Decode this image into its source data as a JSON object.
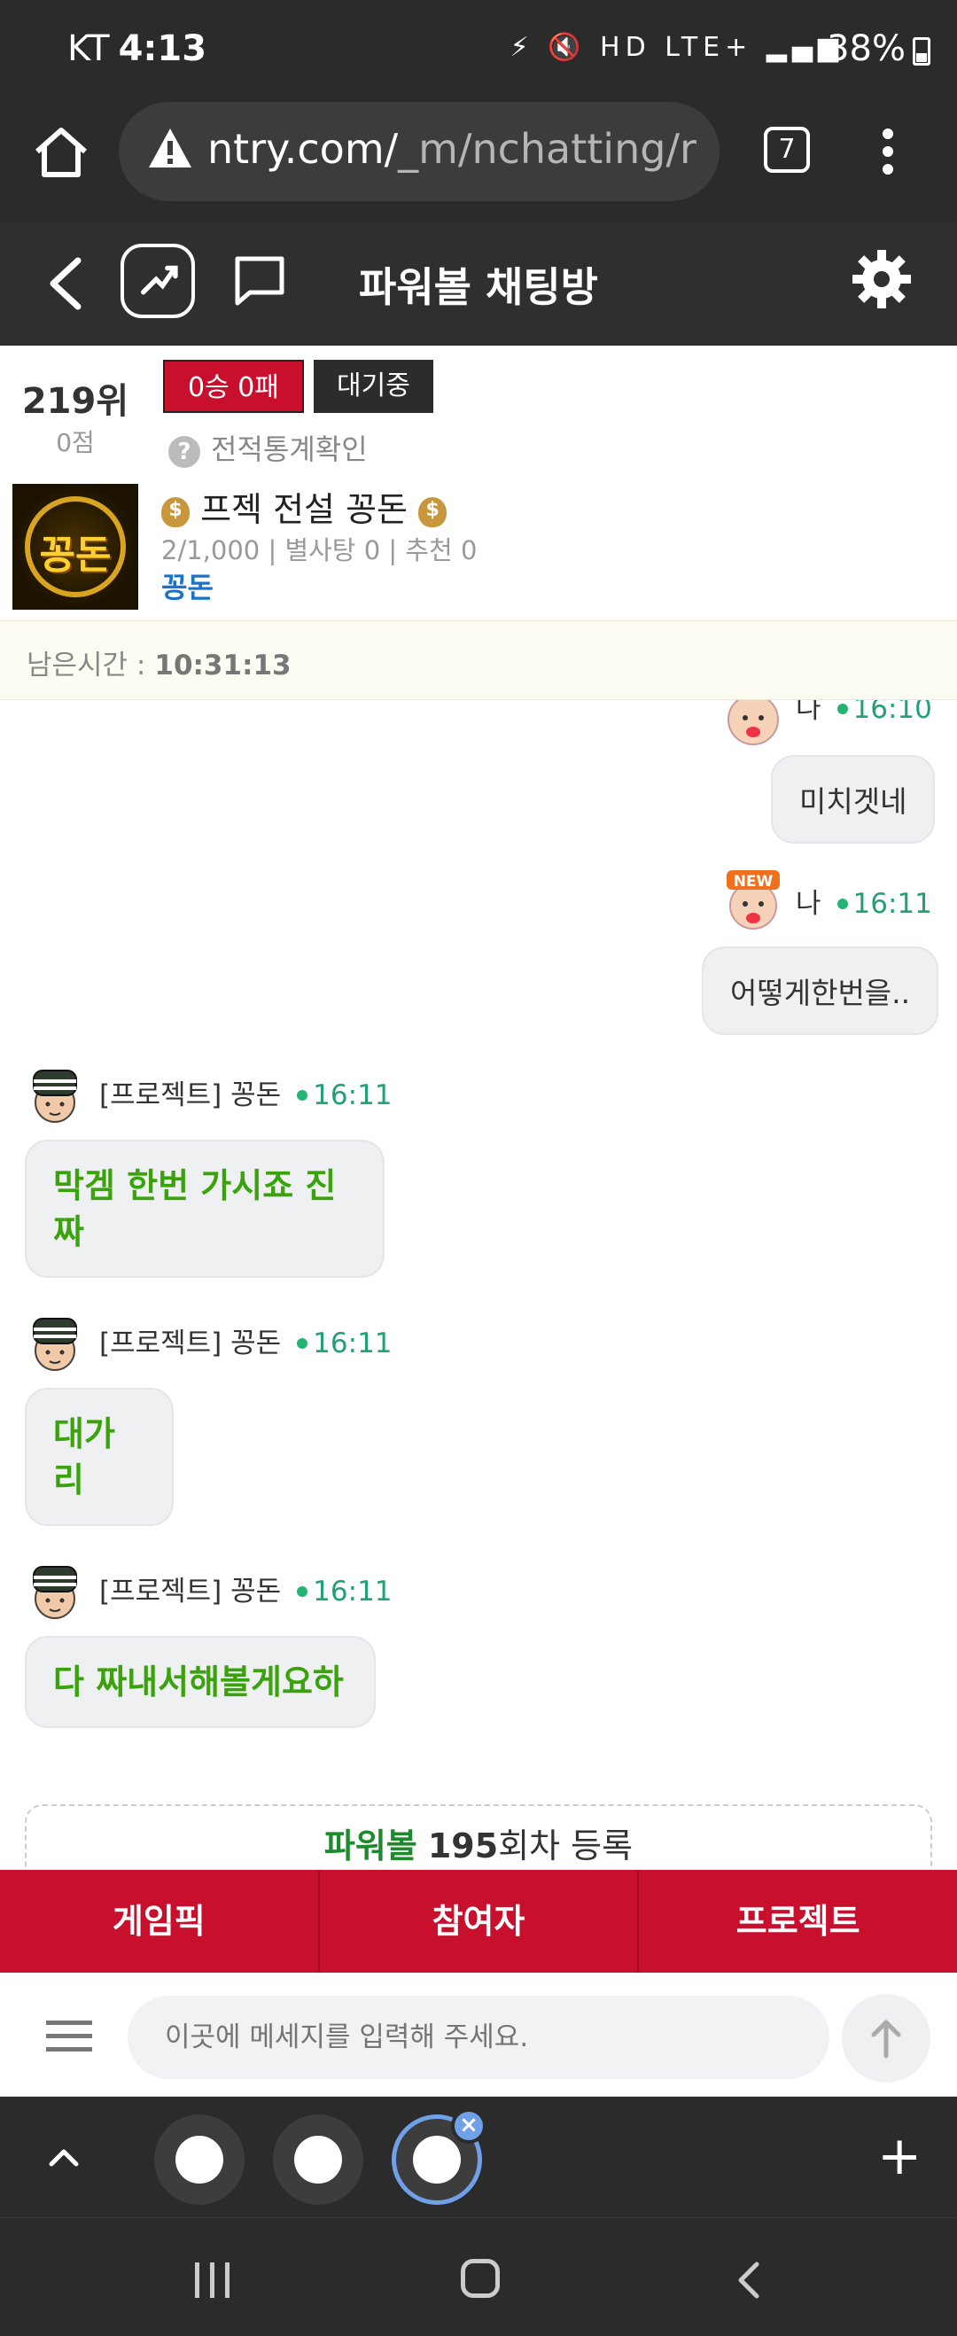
{
  "status_bar": {
    "carrier": "KT",
    "time": "4:13",
    "icons": "⚡ 🔇 HD LTE+ ▂▄▆",
    "battery": "38%"
  },
  "browser": {
    "url_main": "ntry.com/",
    "url_rest": "_m/nchatting/r",
    "tab_count": "7"
  },
  "header": {
    "title": "파워볼 채팅방"
  },
  "profile": {
    "rank": "219위",
    "points": "0점",
    "record": "0승 0패",
    "status": "대기중",
    "stats_link": "전적통계확인",
    "avatar_text": "꽁돈",
    "room_name": "프젝 전설 꽁돈",
    "room_meta": "2/1,000 | 별사탕 0 | 추천 0",
    "owner": "꽁돈"
  },
  "timer": {
    "label": "남은시간 :",
    "value": "10:31:13"
  },
  "messages": [
    {
      "sender": "나",
      "time": "16:10",
      "text": "미치겟네",
      "mine": true
    },
    {
      "sender": "나",
      "time": "16:11",
      "text": "어떻게한번을..",
      "mine": true,
      "badge": "NEW"
    },
    {
      "sender": "[프로젝트] 꽁돈",
      "time": "16:11",
      "text": "막겜 한번 가시죠 진짜",
      "mine": false
    },
    {
      "sender": "[프로젝트] 꽁돈",
      "time": "16:11",
      "text": "대가리",
      "mine": false
    },
    {
      "sender": "[프로젝트] 꽁돈",
      "time": "16:11",
      "text": "다 짜내서해볼게요하",
      "mine": false
    }
  ],
  "register": {
    "game": "파워볼",
    "round": "195",
    "suffix": "회차 등록"
  },
  "tabs": [
    "게임픽",
    "참여자",
    "프로젝트"
  ],
  "input": {
    "placeholder": "이곳에 메세지를 입력해 주세요."
  },
  "colors": {
    "accent_red": "#c8102e",
    "green_text": "#3aa30c",
    "time_green": "#22a07a",
    "link_blue": "#1a73c9"
  }
}
